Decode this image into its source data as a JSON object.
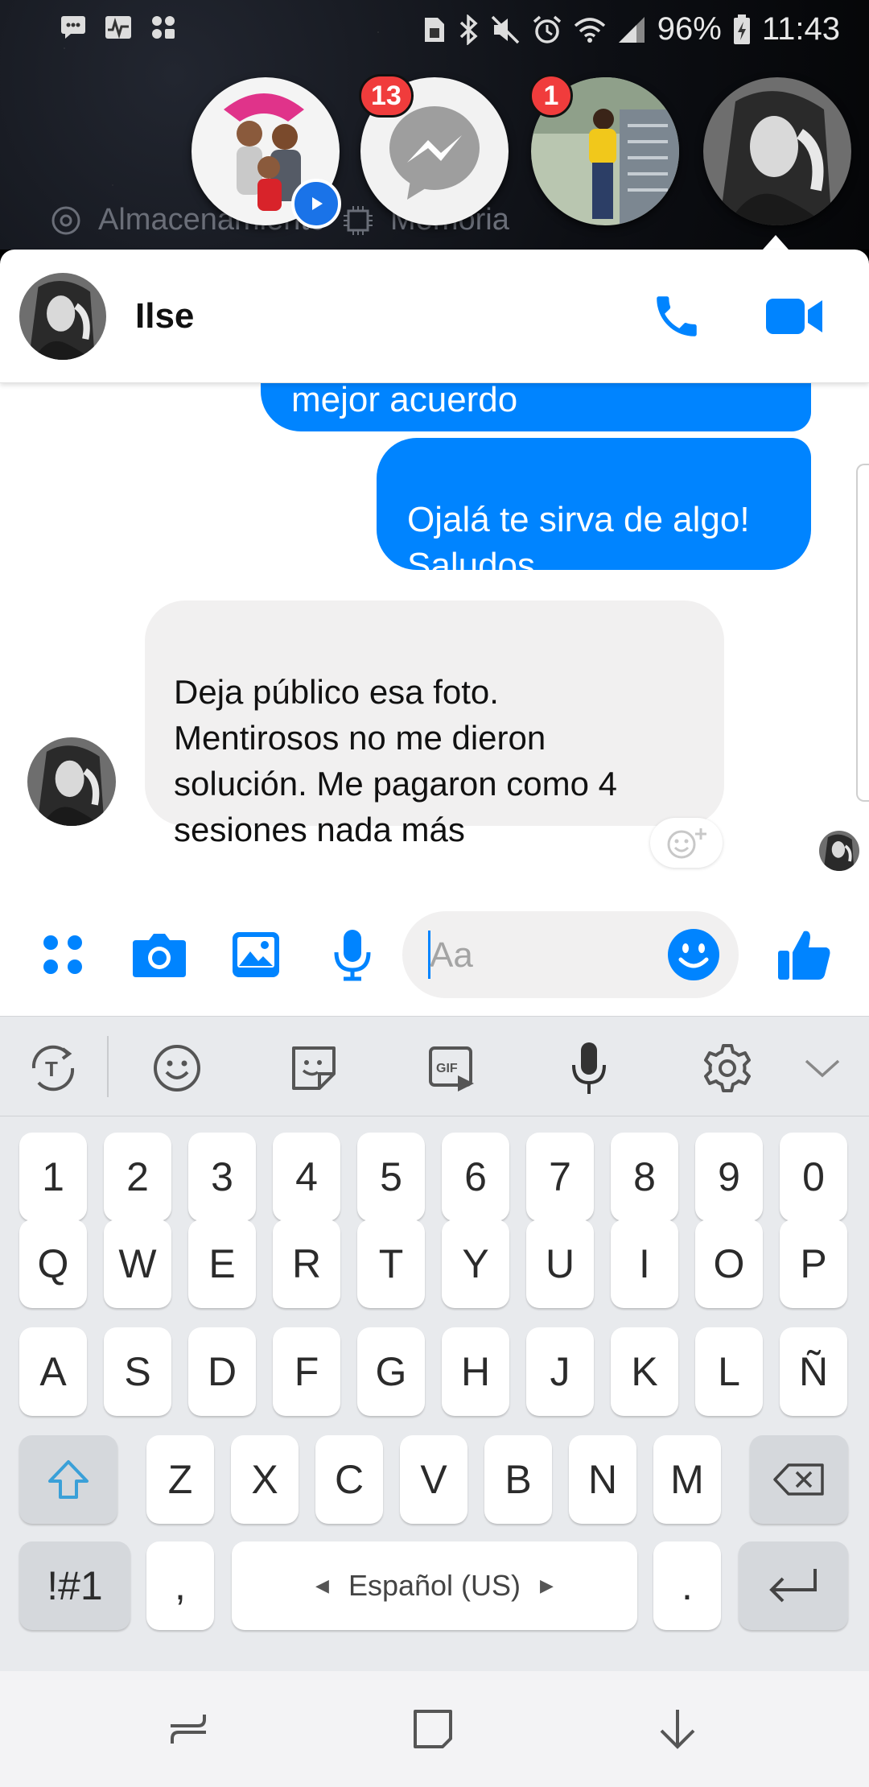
{
  "status_bar": {
    "battery": "96%",
    "time": "11:43"
  },
  "wallpaper_widget": {
    "storage_label": "Almacenamiento",
    "memory_label": "Memoria"
  },
  "chat_heads": [
    {
      "badge": "",
      "has_video": true
    },
    {
      "badge": "13"
    },
    {
      "badge": "1"
    },
    {
      "badge": ""
    }
  ],
  "chat": {
    "contact_name": "Ilse",
    "messages": [
      {
        "direction": "outgoing",
        "text": "mejor acuerdo"
      },
      {
        "direction": "outgoing",
        "text": "Ojalá te sirva de algo!\nSaludos"
      },
      {
        "direction": "incoming",
        "text": "Deja público esa foto.\nMentirosos no me dieron\nsolución.  Me pagaron como 4\nsesiones nada más"
      }
    ]
  },
  "composer": {
    "placeholder": "Aa"
  },
  "keyboard": {
    "number_row": [
      "1",
      "2",
      "3",
      "4",
      "5",
      "6",
      "7",
      "8",
      "9",
      "0"
    ],
    "row1": [
      "Q",
      "W",
      "E",
      "R",
      "T",
      "Y",
      "U",
      "I",
      "O",
      "P"
    ],
    "row2": [
      "A",
      "S",
      "D",
      "F",
      "G",
      "H",
      "J",
      "K",
      "L",
      "Ñ"
    ],
    "row3": [
      "Z",
      "X",
      "C",
      "V",
      "B",
      "N",
      "M"
    ],
    "symbols_label": "!#1",
    "comma": ",",
    "space_label": "Español (US)",
    "period": "."
  },
  "colors": {
    "messenger_blue": "#0084ff",
    "badge_red": "#f03c3c",
    "incoming_bubble": "#f1f0f0"
  }
}
